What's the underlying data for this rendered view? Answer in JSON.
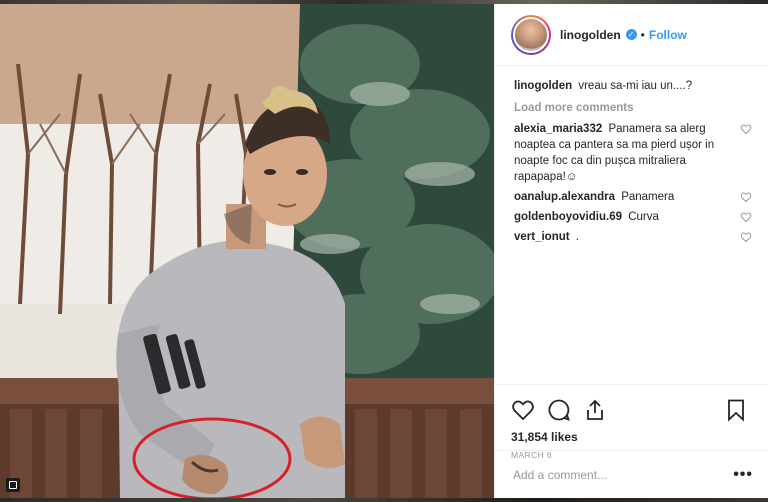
{
  "post": {
    "username": "linogolden",
    "verified": true,
    "follow_label": "Follow",
    "separator": "•",
    "caption_text": "vreau sa-mi iau un....?",
    "load_more_label": "Load more comments",
    "comments": [
      {
        "user": "alexia_maria332",
        "text": "Panamera sa alerg noaptea ca pantera sa ma pierd ușor in noapte foc ca din pușca mitraliera rapapapa!☺"
      },
      {
        "user": "oanalup.alexandra",
        "text": "Panamera"
      },
      {
        "user": "goldenboyovidiu.69",
        "text": "Curva"
      },
      {
        "user": "vert_ionut",
        "text": "."
      }
    ],
    "likes": "31,854 likes",
    "date": "MARCH 6",
    "add_comment_placeholder": "Add a comment...",
    "more_options": "•••"
  },
  "icons": {
    "like": "heart-icon",
    "comment": "comment-bubble-icon",
    "share": "share-icon",
    "save": "bookmark-icon",
    "verified": "verified-badge-icon",
    "multi_photo": "gallery-icon"
  },
  "colors": {
    "accent": "#3897f0",
    "muted": "#999999",
    "text": "#262626",
    "annotation_circle": "#d6202a"
  }
}
